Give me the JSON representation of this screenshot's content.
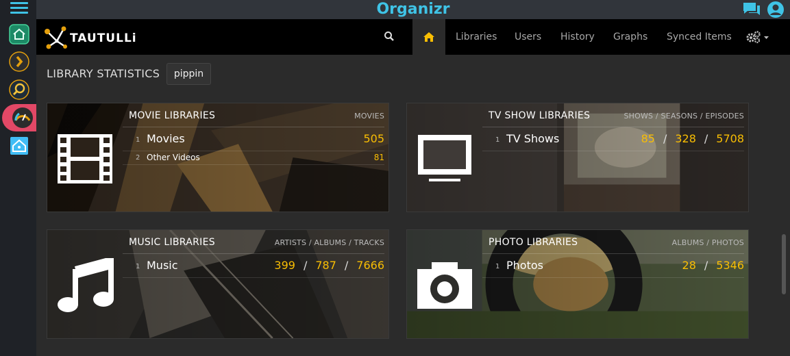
{
  "organizr": {
    "brand": "Organizr",
    "colors": {
      "accent": "#3fc3e6",
      "active": "#e24866"
    },
    "rail_items": [
      {
        "name": "home-icon"
      },
      {
        "name": "plex-icon"
      },
      {
        "name": "ombi-icon"
      },
      {
        "name": "tautulli-icon"
      },
      {
        "name": "home-assistant-icon"
      }
    ]
  },
  "tautulli": {
    "logo_text": "TAUTULLi",
    "nav": {
      "libraries": "Libraries",
      "users": "Users",
      "history": "History",
      "graphs": "Graphs",
      "synced": "Synced Items"
    },
    "colors": {
      "highlight": "#f9be03"
    }
  },
  "page": {
    "title": "LIBRARY STATISTICS",
    "user_button": "pippin"
  },
  "cards": {
    "movie": {
      "title": "MOVIE LIBRARIES",
      "sub": "MOVIES",
      "rows": [
        {
          "num": "1",
          "name": "Movies",
          "v1": "505"
        },
        {
          "num": "2",
          "name": "Other Videos",
          "v1": "81"
        }
      ]
    },
    "tv": {
      "title": "TV SHOW LIBRARIES",
      "sub": "SHOWS / SEASONS / EPISODES",
      "rows": [
        {
          "num": "1",
          "name": "TV Shows",
          "v1": "85",
          "v2": "328",
          "v3": "5708"
        }
      ]
    },
    "music": {
      "title": "MUSIC LIBRARIES",
      "sub": "ARTISTS / ALBUMS / TRACKS",
      "rows": [
        {
          "num": "1",
          "name": "Music",
          "v1": "399",
          "v2": "787",
          "v3": "7666"
        }
      ]
    },
    "photo": {
      "title": "PHOTO LIBRARIES",
      "sub": "ALBUMS / PHOTOS",
      "rows": [
        {
          "num": "1",
          "name": "Photos",
          "v1": "28",
          "v2": "5346"
        }
      ]
    }
  },
  "separator": "/"
}
